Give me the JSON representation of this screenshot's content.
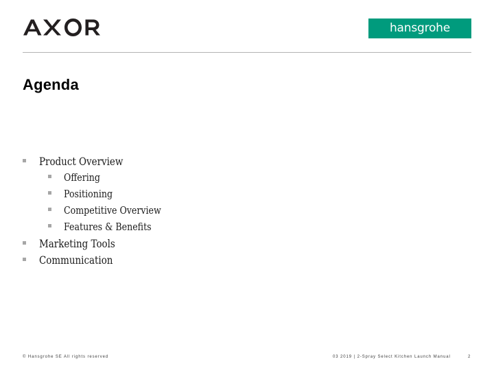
{
  "slide": {
    "title": "Agenda",
    "page_number": "2",
    "background_color": "#ffffff"
  },
  "header": {
    "brand_logo": {
      "name": "AXOR",
      "icon": "axor-wordmark",
      "color": "#231f20"
    },
    "corporate_logo": {
      "name": "hansgrohe",
      "icon": "hansgrohe-wordmark",
      "background_color": "#009B7D",
      "text_color": "#ffffff"
    },
    "rule_color": "#b3b3b3"
  },
  "agenda": {
    "bullet_color": "#a6a6a6",
    "items": [
      {
        "level": 1,
        "label": "Product Overview"
      },
      {
        "level": 2,
        "label": "Offering"
      },
      {
        "level": 2,
        "label": "Positioning"
      },
      {
        "level": 2,
        "label": "Competitive Overview"
      },
      {
        "level": 2,
        "label": "Features & Benefits"
      },
      {
        "level": 1,
        "label": "Marketing Tools"
      },
      {
        "level": 1,
        "label": "Communication"
      }
    ]
  },
  "footer": {
    "copyright": "© Hansgrohe SE  All rights reserved",
    "document_info": "03 2019 | 2-Spray Select Kitchen Launch Manual",
    "page_number": "2"
  }
}
